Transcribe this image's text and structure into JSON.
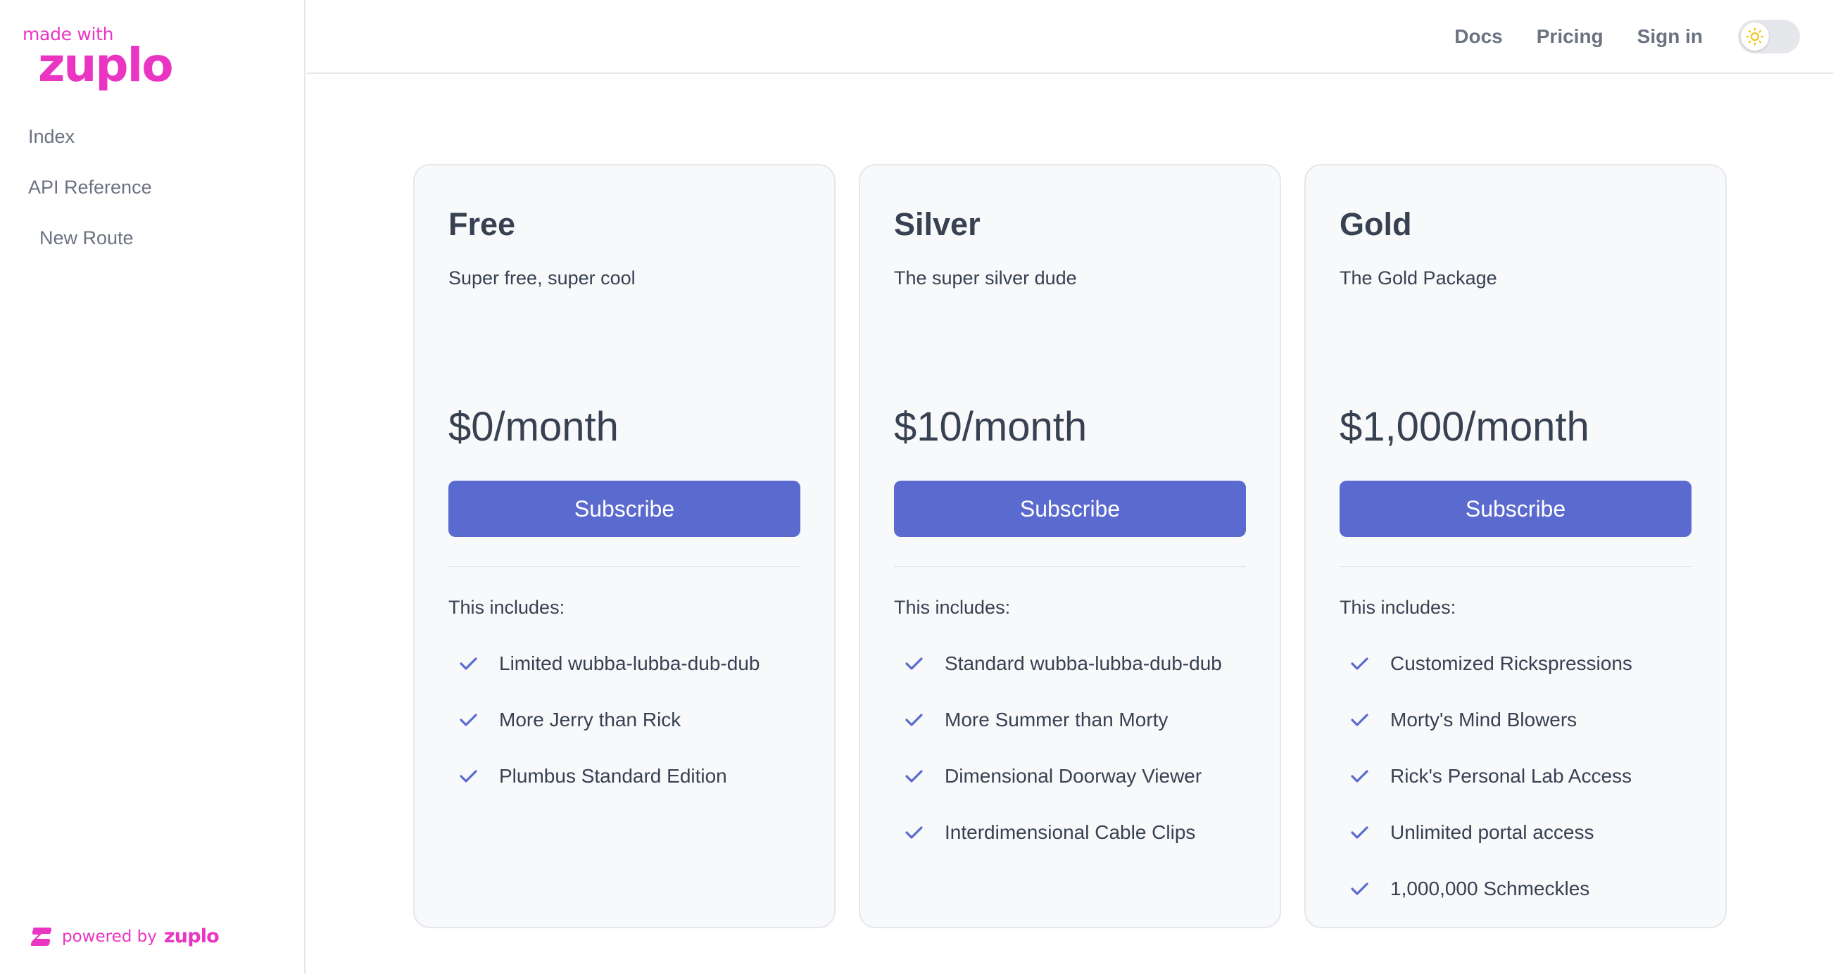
{
  "brand": {
    "made_with": "made with",
    "name": "zuplo",
    "accent_color": "#e935c1"
  },
  "sidebar": {
    "items": [
      {
        "label": "Index",
        "level": 0
      },
      {
        "label": "API Reference",
        "level": 0
      },
      {
        "label": "New Route",
        "level": 1
      }
    ],
    "footer": {
      "powered_by": "powered by",
      "brand": "zuplo",
      "icon": "zuplo-z-icon"
    }
  },
  "header": {
    "links": [
      {
        "label": "Docs"
      },
      {
        "label": "Pricing"
      },
      {
        "label": "Sign in"
      }
    ],
    "theme_toggle": {
      "icon": "sun-icon",
      "mode": "light"
    }
  },
  "pricing": {
    "button_color": "#5a6acf",
    "check_color": "#5a6acf",
    "plans": [
      {
        "name": "Free",
        "description": "Super free, super cool",
        "price": "$0/month",
        "button_label": "Subscribe",
        "includes_label": "This includes:",
        "features": [
          "Limited wubba-lubba-dub-dub",
          "More Jerry than Rick",
          "Plumbus Standard Edition"
        ]
      },
      {
        "name": "Silver",
        "description": "The super silver dude",
        "price": "$10/month",
        "button_label": "Subscribe",
        "includes_label": "This includes:",
        "features": [
          "Standard wubba-lubba-dub-dub",
          "More Summer than Morty",
          "Dimensional Doorway Viewer",
          "Interdimensional Cable Clips"
        ]
      },
      {
        "name": "Gold",
        "description": "The Gold Package",
        "price": "$1,000/month",
        "button_label": "Subscribe",
        "includes_label": "This includes:",
        "features": [
          "Customized Rickspressions",
          "Morty's Mind Blowers",
          "Rick's Personal Lab Access",
          "Unlimited portal access",
          "1,000,000 Schmeckles"
        ]
      }
    ]
  }
}
